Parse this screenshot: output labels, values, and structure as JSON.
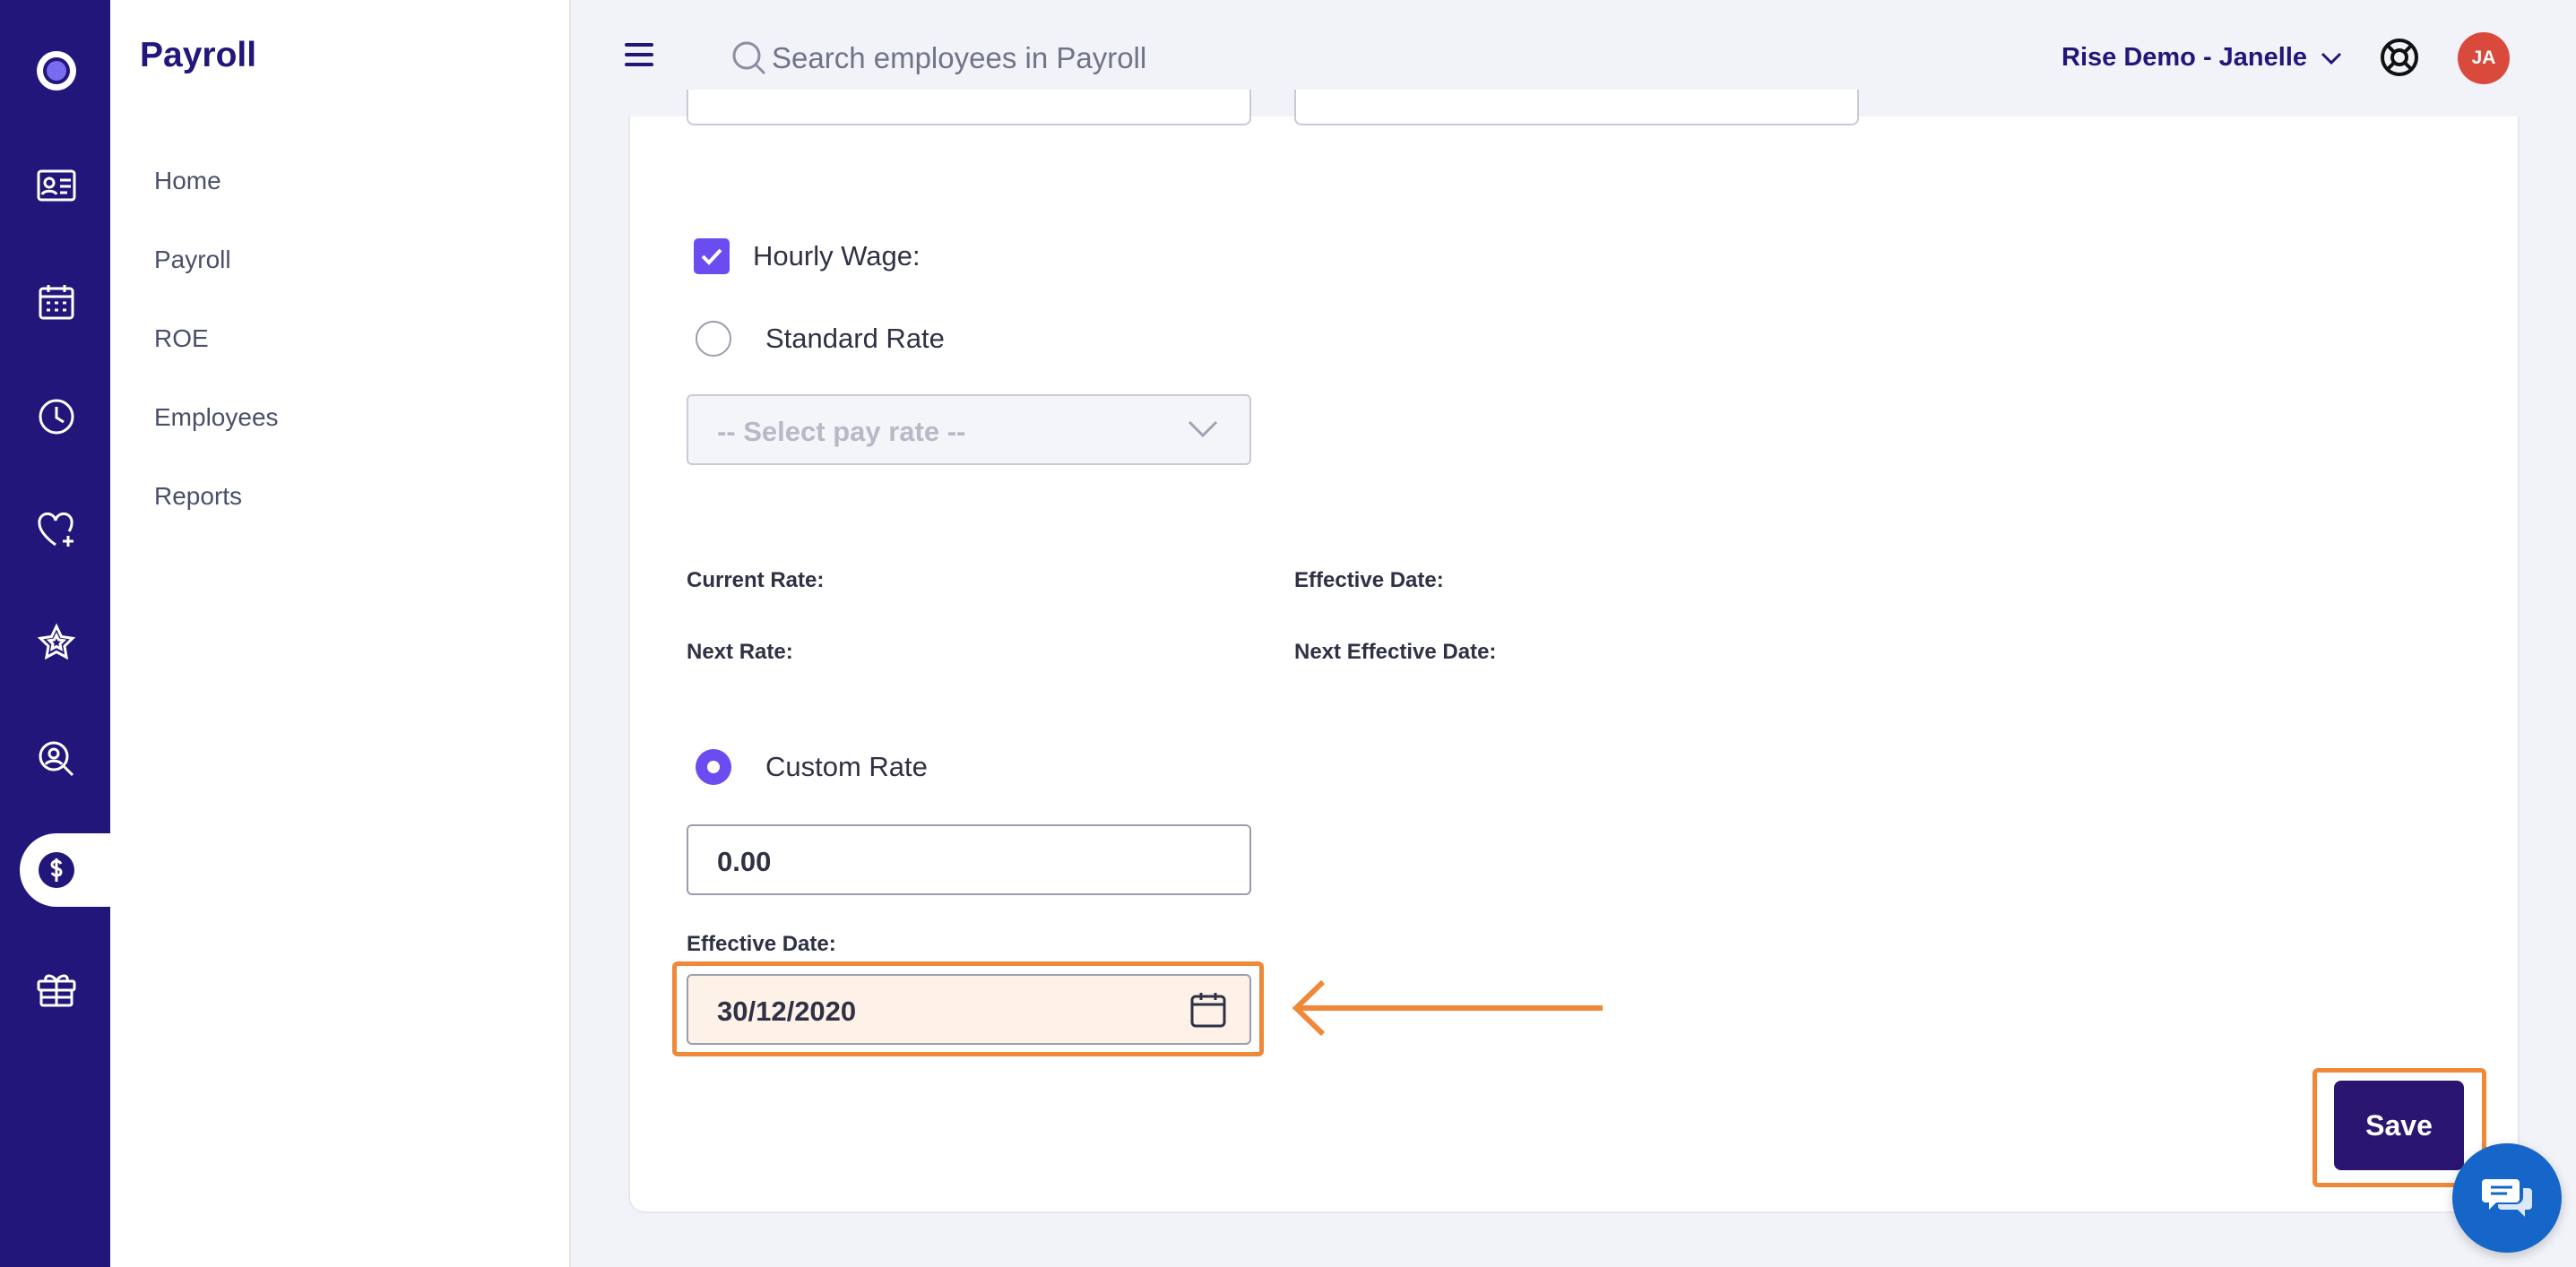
{
  "app": {
    "title": "Payroll"
  },
  "rail": {
    "icons": [
      "logo-icon",
      "id-card-icon",
      "calendar-icon",
      "clock-icon",
      "heart-plus-icon",
      "star-icon",
      "search-person-icon",
      "dollar-icon",
      "gift-box-icon"
    ],
    "active": "dollar-icon"
  },
  "sidebar": {
    "items": [
      {
        "label": "Home"
      },
      {
        "label": "Payroll"
      },
      {
        "label": "ROE"
      },
      {
        "label": "Employees"
      },
      {
        "label": "Reports"
      }
    ]
  },
  "header": {
    "search_placeholder": "Search employees in Payroll",
    "account_name": "Rise Demo - Janelle",
    "avatar_initials": "JA"
  },
  "form": {
    "hourly_wage_label": "Hourly Wage:",
    "hourly_wage_checked": true,
    "standard_rate_label": "Standard Rate",
    "standard_rate_selected": false,
    "pay_rate_select_value": "-- Select pay rate --",
    "current_rate_label": "Current Rate:",
    "effective_date_label": "Effective Date:",
    "next_rate_label": "Next Rate:",
    "next_effective_date_label": "Next Effective Date:",
    "custom_rate_label": "Custom Rate",
    "custom_rate_selected": true,
    "custom_rate_value": "0.00",
    "custom_effective_date_label": "Effective Date:",
    "custom_effective_date_value": "30/12/2020",
    "save_label": "Save"
  },
  "colors": {
    "rail": "#21167a",
    "accent": "#6a4cf0",
    "highlight": "#f0883a",
    "save_button": "#2a1670",
    "chat": "#1665c9"
  }
}
